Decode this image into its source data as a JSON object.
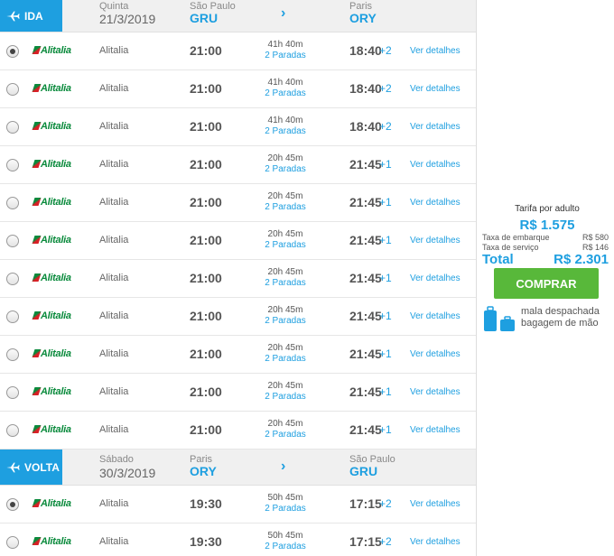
{
  "outbound": {
    "badge": "IDA",
    "day": "Quinta",
    "date": "21/3/2019",
    "origin_city": "São Paulo",
    "origin_code": "GRU",
    "dest_city": "Paris",
    "dest_code": "ORY",
    "arrow": "›",
    "flights": [
      {
        "selected": true,
        "logo": "Alitalia",
        "airline": "Alitalia",
        "dep": "21:00",
        "duration": "41h 40m",
        "stops": "2 Paradas",
        "arr": "18:40",
        "days": "+2",
        "details": "Ver detalhes"
      },
      {
        "selected": false,
        "logo": "Alitalia",
        "airline": "Alitalia",
        "dep": "21:00",
        "duration": "41h 40m",
        "stops": "2 Paradas",
        "arr": "18:40",
        "days": "+2",
        "details": "Ver detalhes"
      },
      {
        "selected": false,
        "logo": "Alitalia",
        "airline": "Alitalia",
        "dep": "21:00",
        "duration": "41h 40m",
        "stops": "2 Paradas",
        "arr": "18:40",
        "days": "+2",
        "details": "Ver detalhes"
      },
      {
        "selected": false,
        "logo": "Alitalia",
        "airline": "Alitalia",
        "dep": "21:00",
        "duration": "20h 45m",
        "stops": "2 Paradas",
        "arr": "21:45",
        "days": "+1",
        "details": "Ver detalhes"
      },
      {
        "selected": false,
        "logo": "Alitalia",
        "airline": "Alitalia",
        "dep": "21:00",
        "duration": "20h 45m",
        "stops": "2 Paradas",
        "arr": "21:45",
        "days": "+1",
        "details": "Ver detalhes"
      },
      {
        "selected": false,
        "logo": "Alitalia",
        "airline": "Alitalia",
        "dep": "21:00",
        "duration": "20h 45m",
        "stops": "2 Paradas",
        "arr": "21:45",
        "days": "+1",
        "details": "Ver detalhes"
      },
      {
        "selected": false,
        "logo": "Alitalia",
        "airline": "Alitalia",
        "dep": "21:00",
        "duration": "20h 45m",
        "stops": "2 Paradas",
        "arr": "21:45",
        "days": "+1",
        "details": "Ver detalhes"
      },
      {
        "selected": false,
        "logo": "Alitalia",
        "airline": "Alitalia",
        "dep": "21:00",
        "duration": "20h 45m",
        "stops": "2 Paradas",
        "arr": "21:45",
        "days": "+1",
        "details": "Ver detalhes"
      },
      {
        "selected": false,
        "logo": "Alitalia",
        "airline": "Alitalia",
        "dep": "21:00",
        "duration": "20h 45m",
        "stops": "2 Paradas",
        "arr": "21:45",
        "days": "+1",
        "details": "Ver detalhes"
      },
      {
        "selected": false,
        "logo": "Alitalia",
        "airline": "Alitalia",
        "dep": "21:00",
        "duration": "20h 45m",
        "stops": "2 Paradas",
        "arr": "21:45",
        "days": "+1",
        "details": "Ver detalhes"
      },
      {
        "selected": false,
        "logo": "Alitalia",
        "airline": "Alitalia",
        "dep": "21:00",
        "duration": "20h 45m",
        "stops": "2 Paradas",
        "arr": "21:45",
        "days": "+1",
        "details": "Ver detalhes"
      }
    ]
  },
  "return": {
    "badge": "VOLTA",
    "day": "Sábado",
    "date": "30/3/2019",
    "origin_city": "Paris",
    "origin_code": "ORY",
    "dest_city": "São Paulo",
    "dest_code": "GRU",
    "arrow": "›",
    "flights": [
      {
        "selected": true,
        "logo": "Alitalia",
        "airline": "Alitalia",
        "dep": "19:30",
        "duration": "50h 45m",
        "stops": "2 Paradas",
        "arr": "17:15",
        "days": "+2",
        "details": "Ver detalhes"
      },
      {
        "selected": false,
        "logo": "Alitalia",
        "airline": "Alitalia",
        "dep": "19:30",
        "duration": "50h 45m",
        "stops": "2 Paradas",
        "arr": "17:15",
        "days": "+2",
        "details": "Ver detalhes"
      }
    ]
  },
  "fare": {
    "label": "Tarifa por adulto",
    "per_adult": "R$ 1.575",
    "boarding_tax_label": "Taxa de embarque",
    "boarding_tax_value": "R$ 580",
    "service_tax_label": "Taxa de serviço",
    "service_tax_value": "R$ 146",
    "total_label": "Total",
    "total_value": "R$ 2.301",
    "buy_label": "COMPRAR",
    "checked_bag": "mala despachada",
    "hand_bag": "bagagem de mão"
  },
  "colors": {
    "accent": "#1e9fe0",
    "buy_button": "#58b83a",
    "alitalia_green": "#0a8a3c",
    "alitalia_red": "#d91f26"
  },
  "icons": {
    "outbound": "plane-departure-icon",
    "return": "plane-arrival-icon",
    "baggage": "luggage-icon"
  }
}
